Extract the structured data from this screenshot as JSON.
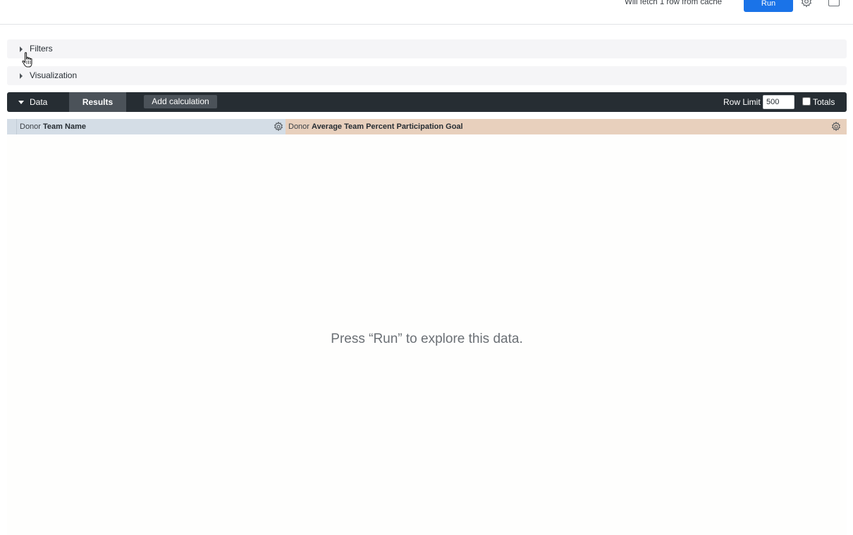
{
  "topbar": {
    "cache_text": "Will fetch 1 row from cache",
    "run_label": "Run"
  },
  "sections": {
    "filters_label": "Filters",
    "visualization_label": "Visualization"
  },
  "databar": {
    "data_label": "Data",
    "results_label": "Results",
    "add_calculation_label": "Add calculation",
    "row_limit_label": "Row Limit",
    "row_limit_value": "500",
    "totals_label": "Totals"
  },
  "columns": [
    {
      "view": "Donor",
      "field": "Team Name"
    },
    {
      "view": "Donor",
      "field": "Average Team Percent Participation Goal"
    }
  ],
  "empty_state": {
    "message": "Press “Run” to explore this data."
  },
  "colors": {
    "run_button": "#1a73e8",
    "databar": "#262d33",
    "dimension_header": "#d4dde6",
    "measure_header": "#e8d0bd"
  }
}
